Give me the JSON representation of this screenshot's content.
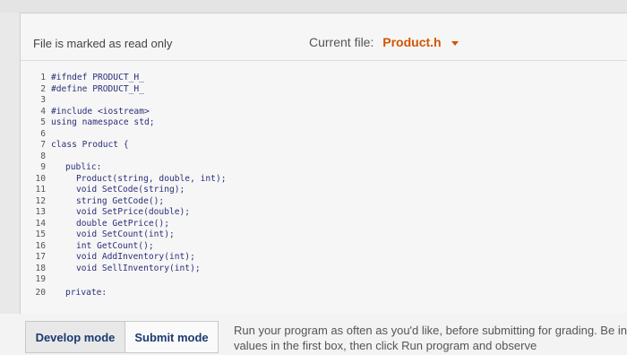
{
  "header": {
    "readonly_note": "File is marked as read only",
    "current_file_label": "Current file:",
    "current_file_name": "Product.h"
  },
  "editor": {
    "lines": [
      {
        "num": "1",
        "text": "#ifndef PRODUCT_H_"
      },
      {
        "num": "2",
        "text": "#define PRODUCT_H_"
      },
      {
        "num": "3",
        "text": ""
      },
      {
        "num": "4",
        "text": "#include <iostream>"
      },
      {
        "num": "5",
        "text": "using namespace std;"
      },
      {
        "num": "6",
        "text": ""
      },
      {
        "num": "7",
        "text": "class Product {"
      },
      {
        "num": "8",
        "text": ""
      },
      {
        "num": "9",
        "text": "public:"
      },
      {
        "num": "10",
        "text": "Product(string, double, int);"
      },
      {
        "num": "11",
        "text": "void SetCode(string);"
      },
      {
        "num": "12",
        "text": "string GetCode();"
      },
      {
        "num": "13",
        "text": "void SetPrice(double);"
      },
      {
        "num": "14",
        "text": "double GetPrice();"
      },
      {
        "num": "15",
        "text": "void SetCount(int);"
      },
      {
        "num": "16",
        "text": "int GetCount();"
      },
      {
        "num": "17",
        "text": "void AddInventory(int);"
      },
      {
        "num": "18",
        "text": "void SellInventory(int);"
      },
      {
        "num": "19",
        "text": ""
      },
      {
        "num": "20",
        "text": "private:"
      }
    ]
  },
  "modes": {
    "develop_label": "Develop mode",
    "submit_label": "Submit mode"
  },
  "instructions": "Run your program as often as you'd like, before submitting for grading. Be input values in the first box, then click Run program and observe"
}
